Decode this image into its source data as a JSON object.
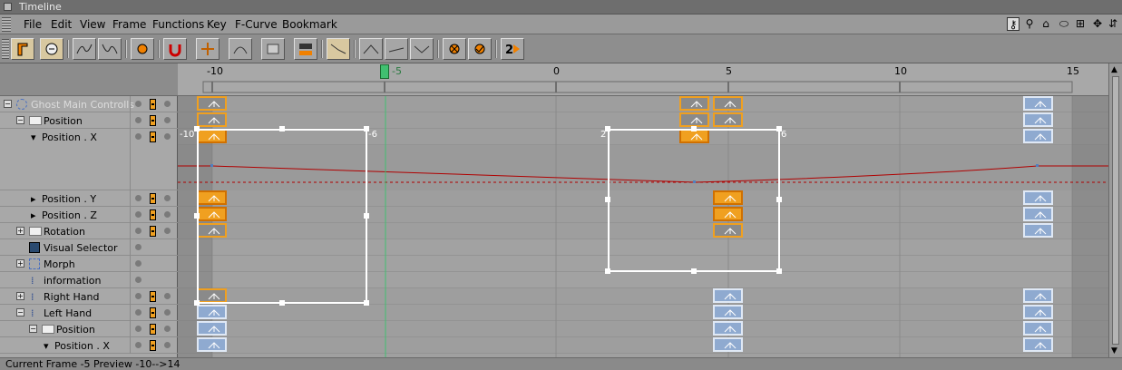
{
  "window": {
    "title": "Timeline"
  },
  "menu": [
    "File",
    "Edit",
    "View",
    "Frame",
    "Functions",
    "Key",
    "F-Curve",
    "Bookmark"
  ],
  "toolbar_right_icons": [
    "key-search-icon",
    "magnifier-icon",
    "home-icon",
    "fold-icon",
    "expand-icon",
    "move-icon",
    "sort-icon"
  ],
  "ruler": {
    "labels": [
      "-10",
      "-5",
      "0",
      "5",
      "10",
      "15"
    ],
    "current_frame_label": "-5"
  },
  "tracks": [
    {
      "label": "Ghost Main Controlls",
      "kind": "object",
      "ghost": true
    },
    {
      "label": "Position",
      "kind": "folder"
    },
    {
      "label": "Position . X",
      "kind": "param"
    },
    {
      "label": "Position . Y",
      "kind": "param"
    },
    {
      "label": "Position . Z",
      "kind": "param"
    },
    {
      "label": "Rotation",
      "kind": "folder"
    },
    {
      "label": "Visual Selector",
      "kind": "object"
    },
    {
      "label": "Morph",
      "kind": "object"
    },
    {
      "label": "information",
      "kind": "object"
    },
    {
      "label": "Right Hand",
      "kind": "object"
    },
    {
      "label": "Left Hand",
      "kind": "object"
    },
    {
      "label": "Position",
      "kind": "folder"
    },
    {
      "label": "Position . X",
      "kind": "param"
    }
  ],
  "selection_labels": {
    "box1_left": "-10",
    "box1_right": "-6",
    "box2_left": "2",
    "box2_right": "6"
  },
  "status": {
    "text": "Current Frame  -5  Preview  -10-->14"
  },
  "colors": {
    "selected_key": "#f0a020",
    "blue_key": "#8faad0",
    "fcurve": "#b00000",
    "playhead": "#40c070"
  }
}
